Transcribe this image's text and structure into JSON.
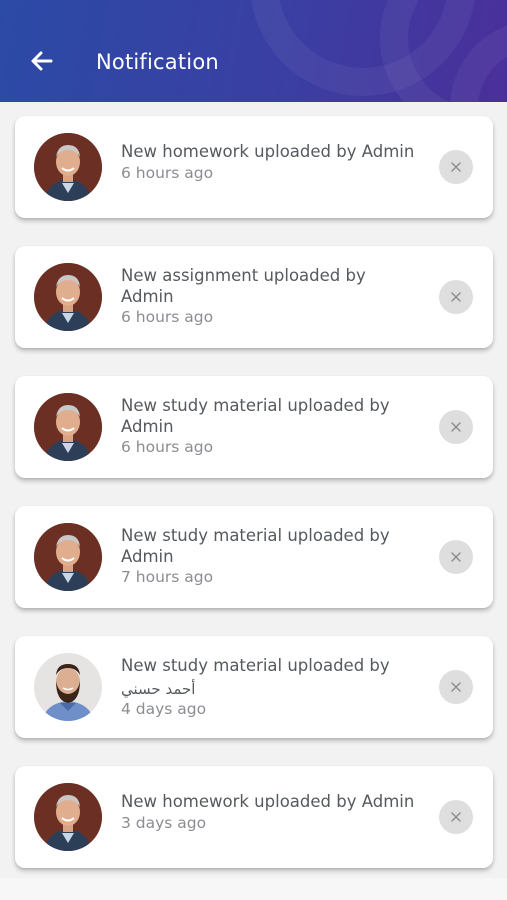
{
  "header": {
    "title": "Notification",
    "back_icon": "arrow-left-icon",
    "gradient_start": "#2b4aa6",
    "gradient_end": "#4a2f9a"
  },
  "notifications": [
    {
      "line1": "New homework uploaded by  Admin",
      "line2": "",
      "time": "6 hours ago",
      "avatar": "older-man-avatar"
    },
    {
      "line1": "New assignment uploaded by",
      "line2": "Admin",
      "time": "6 hours ago",
      "avatar": "older-man-avatar"
    },
    {
      "line1": "New study material uploaded by",
      "line2": "Admin",
      "time": "6 hours ago",
      "avatar": "older-man-avatar"
    },
    {
      "line1": "New study material uploaded by",
      "line2": "Admin",
      "time": "7 hours ago",
      "avatar": "older-man-avatar"
    },
    {
      "line1": "New study material uploaded by",
      "line2": "أحمد حسني",
      "time": "4 days ago",
      "avatar": "bearded-man-avatar"
    },
    {
      "line1": "New homework uploaded by  Admin",
      "line2": "",
      "time": "3 days ago",
      "avatar": "older-man-avatar"
    }
  ],
  "dismiss_icon": "close-icon"
}
